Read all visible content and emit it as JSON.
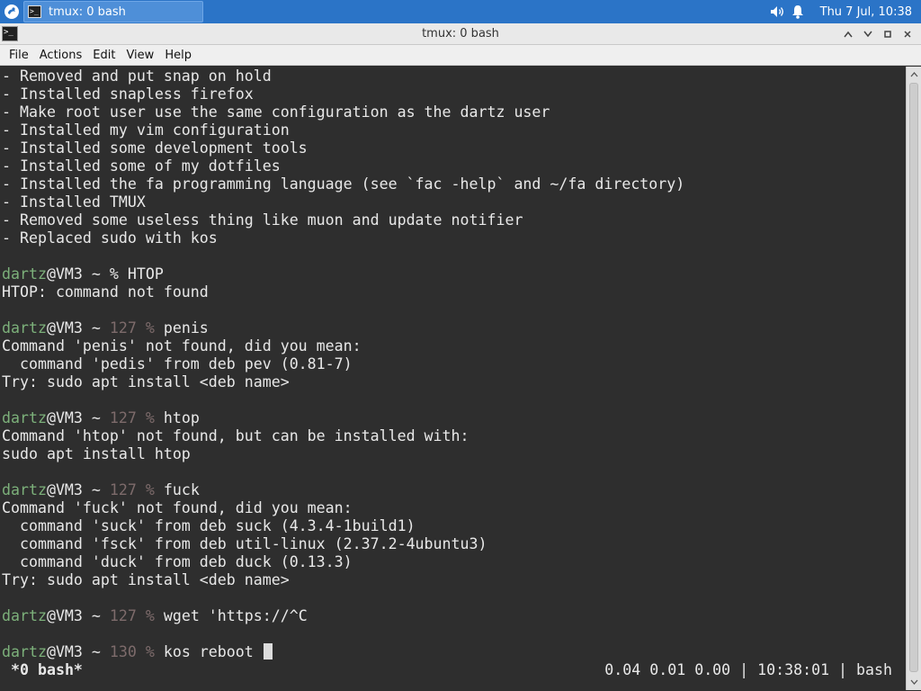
{
  "panel": {
    "task_label": "tmux: 0 bash",
    "clock": "Thu  7 Jul, 10:38"
  },
  "window": {
    "title": "tmux: 0 bash"
  },
  "menu": [
    "File",
    "Actions",
    "Edit",
    "View",
    "Help"
  ],
  "terminal": {
    "intro_lines": [
      "- Removed and put snap on hold",
      "- Installed snapless firefox",
      "- Make root user use the same configuration as the dartz user",
      "- Installed my vim configuration",
      "- Installed some development tools",
      "- Installed some of my dotfiles",
      "- Installed the fa programming language (see `fac -help` and ~/fa directory)",
      "- Installed TMUX",
      "- Removed some useless thing like muon and update notifier",
      "- Replaced sudo with kos"
    ],
    "prompt_user": "dartz",
    "prompt_host": "@VM3 ~ ",
    "sessions": [
      {
        "code": "",
        "command": "HTOP",
        "output": [
          "HTOP: command not found"
        ]
      },
      {
        "code": "127",
        "command": "penis",
        "output": [
          "Command 'penis' not found, did you mean:",
          "  command 'pedis' from deb pev (0.81-7)",
          "Try: sudo apt install <deb name>"
        ]
      },
      {
        "code": "127",
        "command": "htop",
        "output": [
          "Command 'htop' not found, but can be installed with:",
          "sudo apt install htop"
        ]
      },
      {
        "code": "127",
        "command": "fuck",
        "output": [
          "Command 'fuck' not found, did you mean:",
          "  command 'suck' from deb suck (4.3.4-1build1)",
          "  command 'fsck' from deb util-linux (2.37.2-4ubuntu3)",
          "  command 'duck' from deb duck (0.13.3)",
          "Try: sudo apt install <deb name>"
        ]
      },
      {
        "code": "127",
        "command": "wget 'https://^C",
        "output": []
      },
      {
        "code": "130",
        "command": "kos reboot ",
        "output": [],
        "cursor": true
      }
    ]
  },
  "status": {
    "window": "*0 bash*",
    "right": "0.04 0.01 0.00 | 10:38:01 | bash"
  },
  "colors": {
    "panel": "#2b74c7",
    "terminal_bg": "#2e2e2e",
    "prompt_user": "#7cb07a",
    "exit_code": "#7d6b6b"
  }
}
